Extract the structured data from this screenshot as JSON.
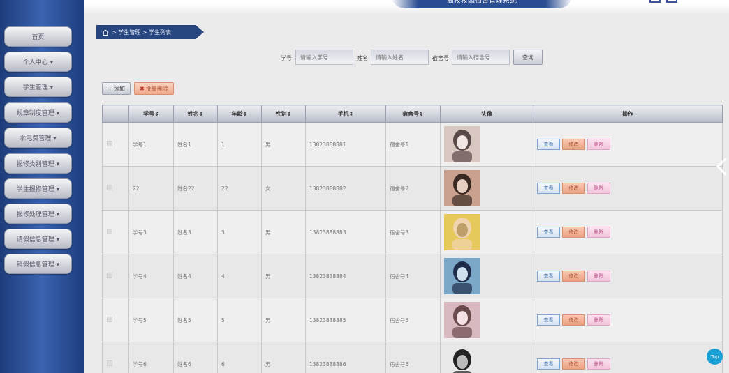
{
  "header": {
    "title": "高校校园宿舍管理系统"
  },
  "sidebar": {
    "items": [
      {
        "label": "首页"
      },
      {
        "label": "个人中心 ▾"
      },
      {
        "label": "学生管理 ▾"
      },
      {
        "label": "规章制度管理 ▾"
      },
      {
        "label": "水电费管理 ▾"
      },
      {
        "label": "报修类别管理 ▾"
      },
      {
        "label": "学生报修管理 ▾"
      },
      {
        "label": "报修处理管理 ▾"
      },
      {
        "label": "请假信息管理 ▾"
      },
      {
        "label": "销假信息管理 ▾"
      }
    ]
  },
  "breadcrumb": {
    "text": " > 学生管理 > 学生列表"
  },
  "search": {
    "student_no_label": "学号",
    "student_no_placeholder": "请输入学号",
    "name_label": "姓名",
    "name_placeholder": "请输入姓名",
    "dorm_label": "宿舍号",
    "dorm_placeholder": "请输入宿舍号",
    "query_label": "查询"
  },
  "toolbar": {
    "add_label": "添加",
    "batch_delete_label": "批量删除"
  },
  "table": {
    "headers": [
      "学号",
      "姓名",
      "年龄",
      "性别",
      "手机",
      "宿舍号",
      "头像",
      "操作"
    ],
    "rows": [
      {
        "student_no": "学号1",
        "name": "姓名1",
        "age": "1",
        "gender": "男",
        "phone": "13823888881",
        "dorm": "宿舍号1"
      },
      {
        "student_no": "22",
        "name": "姓名22",
        "age": "22",
        "gender": "女",
        "phone": "13823888882",
        "dorm": "宿舍号2"
      },
      {
        "student_no": "学号3",
        "name": "姓名3",
        "age": "3",
        "gender": "男",
        "phone": "13823888883",
        "dorm": "宿舍号3"
      },
      {
        "student_no": "学号4",
        "name": "姓名4",
        "age": "4",
        "gender": "男",
        "phone": "13823888884",
        "dorm": "宿舍号4"
      },
      {
        "student_no": "学号5",
        "name": "姓名5",
        "age": "5",
        "gender": "男",
        "phone": "13823888885",
        "dorm": "宿舍号5"
      },
      {
        "student_no": "学号6",
        "name": "姓名6",
        "age": "6",
        "gender": "男",
        "phone": "13823888886",
        "dorm": "宿舍号6"
      }
    ],
    "actions": {
      "view": "查看",
      "edit": "修改",
      "delete": "删除"
    }
  },
  "top_button": {
    "label": "Top"
  },
  "colors": {
    "sidebar": "#2a4d93",
    "accent": "#19a0d6",
    "delete": "#f2c4dc",
    "edit": "#eaa283"
  }
}
